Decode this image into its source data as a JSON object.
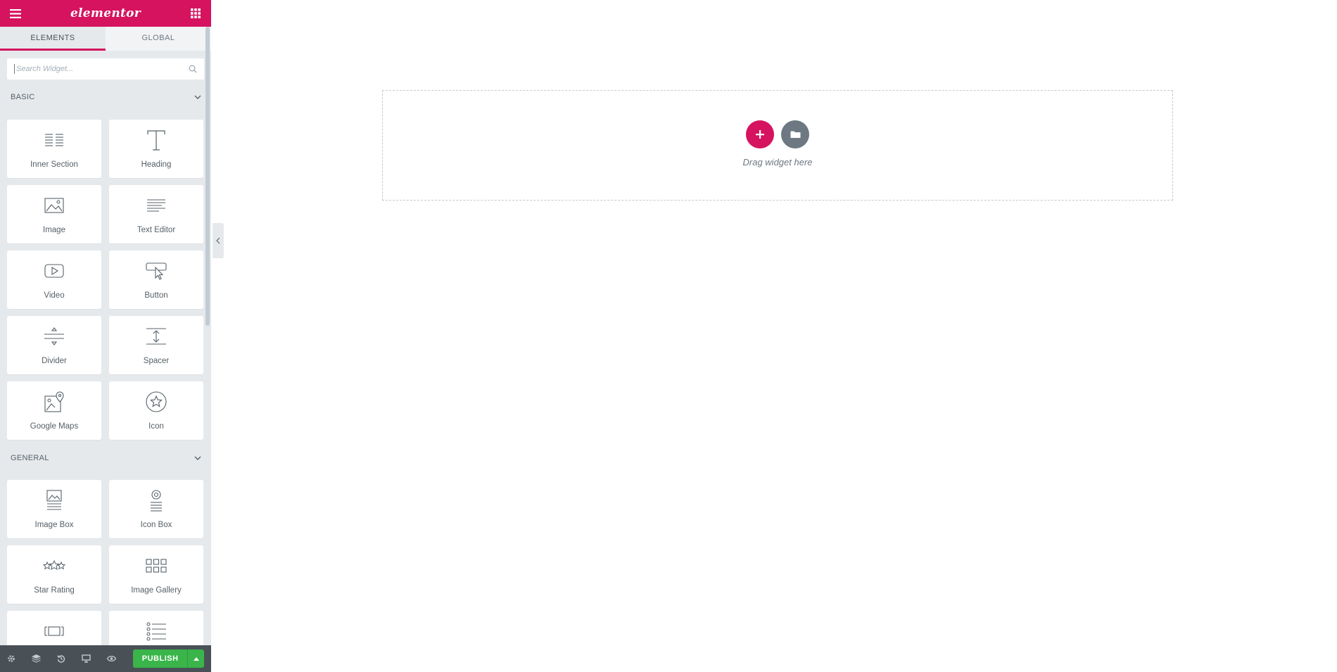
{
  "brand": "elementor",
  "tabs": [
    {
      "label": "ELEMENTS",
      "active": true
    },
    {
      "label": "GLOBAL",
      "active": false
    }
  ],
  "search": {
    "placeholder": "Search Widget..."
  },
  "categories": [
    {
      "title": "BASIC",
      "widgets": [
        {
          "label": "Inner Section",
          "icon": "inner-section-icon"
        },
        {
          "label": "Heading",
          "icon": "heading-icon"
        },
        {
          "label": "Image",
          "icon": "image-icon"
        },
        {
          "label": "Text Editor",
          "icon": "text-editor-icon"
        },
        {
          "label": "Video",
          "icon": "video-icon"
        },
        {
          "label": "Button",
          "icon": "button-icon"
        },
        {
          "label": "Divider",
          "icon": "divider-icon"
        },
        {
          "label": "Spacer",
          "icon": "spacer-icon"
        },
        {
          "label": "Google Maps",
          "icon": "google-maps-icon"
        },
        {
          "label": "Icon",
          "icon": "star-circle-icon"
        }
      ]
    },
    {
      "title": "GENERAL",
      "widgets": [
        {
          "label": "Image Box",
          "icon": "image-box-icon"
        },
        {
          "label": "Icon Box",
          "icon": "icon-box-icon"
        },
        {
          "label": "Star Rating",
          "icon": "star-rating-icon"
        },
        {
          "label": "Image Gallery",
          "icon": "image-gallery-icon"
        },
        {
          "label": "",
          "icon": "image-carousel-icon"
        },
        {
          "label": "",
          "icon": "icon-list-icon"
        }
      ]
    }
  ],
  "footer": {
    "icons": [
      "settings-icon",
      "navigator-icon",
      "history-icon",
      "responsive-icon",
      "preview-icon"
    ],
    "publish_label": "PUBLISH"
  },
  "canvas": {
    "drop_text": "Drag widget here"
  },
  "colors": {
    "brand": "#d5135f",
    "publish": "#39b54a",
    "footer": "#495157",
    "panel": "#e6e9ec"
  }
}
